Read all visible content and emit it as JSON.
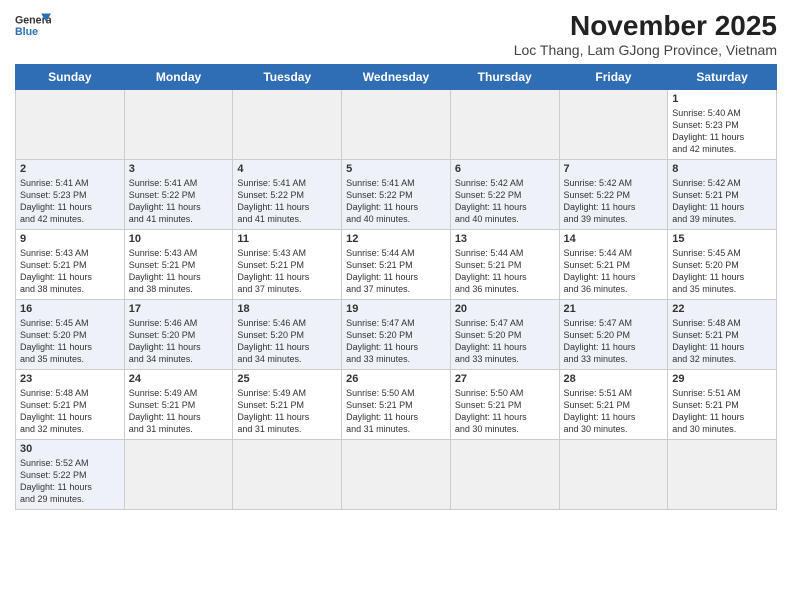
{
  "header": {
    "logo_line1": "General",
    "logo_line2": "Blue",
    "title": "November 2025",
    "subtitle": "Loc Thang, Lam GJong Province, Vietnam"
  },
  "days_of_week": [
    "Sunday",
    "Monday",
    "Tuesday",
    "Wednesday",
    "Thursday",
    "Friday",
    "Saturday"
  ],
  "weeks": [
    [
      {
        "day": "",
        "info": ""
      },
      {
        "day": "",
        "info": ""
      },
      {
        "day": "",
        "info": ""
      },
      {
        "day": "",
        "info": ""
      },
      {
        "day": "",
        "info": ""
      },
      {
        "day": "",
        "info": ""
      },
      {
        "day": "1",
        "info": "Sunrise: 5:40 AM\nSunset: 5:23 PM\nDaylight: 11 hours\nand 42 minutes."
      }
    ],
    [
      {
        "day": "2",
        "info": "Sunrise: 5:41 AM\nSunset: 5:23 PM\nDaylight: 11 hours\nand 42 minutes."
      },
      {
        "day": "3",
        "info": "Sunrise: 5:41 AM\nSunset: 5:22 PM\nDaylight: 11 hours\nand 41 minutes."
      },
      {
        "day": "4",
        "info": "Sunrise: 5:41 AM\nSunset: 5:22 PM\nDaylight: 11 hours\nand 41 minutes."
      },
      {
        "day": "5",
        "info": "Sunrise: 5:41 AM\nSunset: 5:22 PM\nDaylight: 11 hours\nand 40 minutes."
      },
      {
        "day": "6",
        "info": "Sunrise: 5:42 AM\nSunset: 5:22 PM\nDaylight: 11 hours\nand 40 minutes."
      },
      {
        "day": "7",
        "info": "Sunrise: 5:42 AM\nSunset: 5:22 PM\nDaylight: 11 hours\nand 39 minutes."
      },
      {
        "day": "8",
        "info": "Sunrise: 5:42 AM\nSunset: 5:21 PM\nDaylight: 11 hours\nand 39 minutes."
      }
    ],
    [
      {
        "day": "9",
        "info": "Sunrise: 5:43 AM\nSunset: 5:21 PM\nDaylight: 11 hours\nand 38 minutes."
      },
      {
        "day": "10",
        "info": "Sunrise: 5:43 AM\nSunset: 5:21 PM\nDaylight: 11 hours\nand 38 minutes."
      },
      {
        "day": "11",
        "info": "Sunrise: 5:43 AM\nSunset: 5:21 PM\nDaylight: 11 hours\nand 37 minutes."
      },
      {
        "day": "12",
        "info": "Sunrise: 5:44 AM\nSunset: 5:21 PM\nDaylight: 11 hours\nand 37 minutes."
      },
      {
        "day": "13",
        "info": "Sunrise: 5:44 AM\nSunset: 5:21 PM\nDaylight: 11 hours\nand 36 minutes."
      },
      {
        "day": "14",
        "info": "Sunrise: 5:44 AM\nSunset: 5:21 PM\nDaylight: 11 hours\nand 36 minutes."
      },
      {
        "day": "15",
        "info": "Sunrise: 5:45 AM\nSunset: 5:20 PM\nDaylight: 11 hours\nand 35 minutes."
      }
    ],
    [
      {
        "day": "16",
        "info": "Sunrise: 5:45 AM\nSunset: 5:20 PM\nDaylight: 11 hours\nand 35 minutes."
      },
      {
        "day": "17",
        "info": "Sunrise: 5:46 AM\nSunset: 5:20 PM\nDaylight: 11 hours\nand 34 minutes."
      },
      {
        "day": "18",
        "info": "Sunrise: 5:46 AM\nSunset: 5:20 PM\nDaylight: 11 hours\nand 34 minutes."
      },
      {
        "day": "19",
        "info": "Sunrise: 5:47 AM\nSunset: 5:20 PM\nDaylight: 11 hours\nand 33 minutes."
      },
      {
        "day": "20",
        "info": "Sunrise: 5:47 AM\nSunset: 5:20 PM\nDaylight: 11 hours\nand 33 minutes."
      },
      {
        "day": "21",
        "info": "Sunrise: 5:47 AM\nSunset: 5:20 PM\nDaylight: 11 hours\nand 33 minutes."
      },
      {
        "day": "22",
        "info": "Sunrise: 5:48 AM\nSunset: 5:21 PM\nDaylight: 11 hours\nand 32 minutes."
      }
    ],
    [
      {
        "day": "23",
        "info": "Sunrise: 5:48 AM\nSunset: 5:21 PM\nDaylight: 11 hours\nand 32 minutes."
      },
      {
        "day": "24",
        "info": "Sunrise: 5:49 AM\nSunset: 5:21 PM\nDaylight: 11 hours\nand 31 minutes."
      },
      {
        "day": "25",
        "info": "Sunrise: 5:49 AM\nSunset: 5:21 PM\nDaylight: 11 hours\nand 31 minutes."
      },
      {
        "day": "26",
        "info": "Sunrise: 5:50 AM\nSunset: 5:21 PM\nDaylight: 11 hours\nand 31 minutes."
      },
      {
        "day": "27",
        "info": "Sunrise: 5:50 AM\nSunset: 5:21 PM\nDaylight: 11 hours\nand 30 minutes."
      },
      {
        "day": "28",
        "info": "Sunrise: 5:51 AM\nSunset: 5:21 PM\nDaylight: 11 hours\nand 30 minutes."
      },
      {
        "day": "29",
        "info": "Sunrise: 5:51 AM\nSunset: 5:21 PM\nDaylight: 11 hours\nand 30 minutes."
      }
    ],
    [
      {
        "day": "30",
        "info": "Sunrise: 5:52 AM\nSunset: 5:22 PM\nDaylight: 11 hours\nand 29 minutes."
      },
      {
        "day": "",
        "info": ""
      },
      {
        "day": "",
        "info": ""
      },
      {
        "day": "",
        "info": ""
      },
      {
        "day": "",
        "info": ""
      },
      {
        "day": "",
        "info": ""
      },
      {
        "day": "",
        "info": ""
      }
    ]
  ]
}
